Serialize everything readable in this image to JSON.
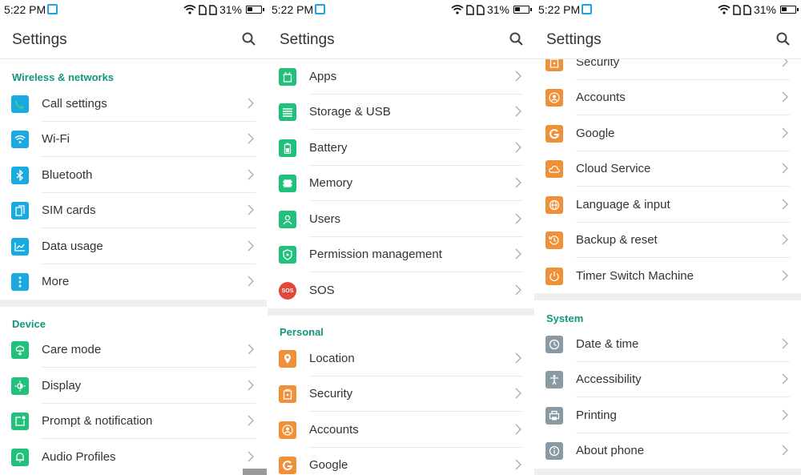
{
  "status": {
    "time": "5:22 PM",
    "battery": "31%"
  },
  "panels": [
    {
      "title": "Settings",
      "sections": [
        {
          "header": "Wireless & networks",
          "items": [
            {
              "label": "Call settings",
              "icon": "phone-icon",
              "color": "#1aa9e0"
            },
            {
              "label": "Wi-Fi",
              "icon": "wifi-icon",
              "color": "#1aa9e0"
            },
            {
              "label": "Bluetooth",
              "icon": "bluetooth-icon",
              "color": "#1aa9e0"
            },
            {
              "label": "SIM cards",
              "icon": "sim-icon",
              "color": "#1aa9e0"
            },
            {
              "label": "Data usage",
              "icon": "chart-icon",
              "color": "#1aa9e0"
            },
            {
              "label": "More",
              "icon": "more-icon",
              "color": "#1aa9e0"
            }
          ]
        },
        {
          "header": "Device",
          "items": [
            {
              "label": "Care mode",
              "icon": "care-icon",
              "color": "#21c17c"
            },
            {
              "label": "Display",
              "icon": "display-icon",
              "color": "#21c17c"
            },
            {
              "label": "Prompt & notification",
              "icon": "notification-icon",
              "color": "#21c17c"
            },
            {
              "label": "Audio Profiles",
              "icon": "bell-icon",
              "color": "#21c17c"
            }
          ]
        }
      ]
    },
    {
      "title": "Settings",
      "sections": [
        {
          "header": "",
          "items": [
            {
              "label": "Apps",
              "icon": "android-icon",
              "color": "#21c17c"
            },
            {
              "label": "Storage & USB",
              "icon": "storage-icon",
              "color": "#21c17c"
            },
            {
              "label": "Battery",
              "icon": "battery-icon",
              "color": "#21c17c"
            },
            {
              "label": "Memory",
              "icon": "memory-icon",
              "color": "#21c17c"
            },
            {
              "label": "Users",
              "icon": "user-icon",
              "color": "#21c17c"
            },
            {
              "label": "Permission management",
              "icon": "shield-icon",
              "color": "#21c17c"
            },
            {
              "label": "SOS",
              "icon": "sos-icon",
              "color": "#e0483a"
            }
          ]
        },
        {
          "header": "Personal",
          "items": [
            {
              "label": "Location",
              "icon": "location-icon",
              "color": "#f0913a"
            },
            {
              "label": "Security",
              "icon": "lock-icon",
              "color": "#f0913a"
            },
            {
              "label": "Accounts",
              "icon": "account-icon",
              "color": "#f0913a"
            },
            {
              "label": "Google",
              "icon": "google-icon",
              "color": "#f0913a"
            }
          ]
        }
      ]
    },
    {
      "title": "Settings",
      "sections": [
        {
          "header": "",
          "items": [
            {
              "label": "Security",
              "icon": "lock-icon",
              "color": "#f0913a"
            },
            {
              "label": "Accounts",
              "icon": "account-icon",
              "color": "#f0913a"
            },
            {
              "label": "Google",
              "icon": "google-icon",
              "color": "#f0913a"
            },
            {
              "label": "Cloud Service",
              "icon": "cloud-icon",
              "color": "#f0913a"
            },
            {
              "label": "Language & input",
              "icon": "globe-icon",
              "color": "#f0913a"
            },
            {
              "label": "Backup & reset",
              "icon": "backup-icon",
              "color": "#f0913a"
            },
            {
              "label": "Timer Switch Machine",
              "icon": "power-icon",
              "color": "#f0913a"
            }
          ]
        },
        {
          "header": "System",
          "items": [
            {
              "label": "Date & time",
              "icon": "clock-icon",
              "color": "#8a9aa5"
            },
            {
              "label": "Accessibility",
              "icon": "accessibility-icon",
              "color": "#8a9aa5"
            },
            {
              "label": "Printing",
              "icon": "printer-icon",
              "color": "#8a9aa5"
            },
            {
              "label": "About phone",
              "icon": "info-icon",
              "color": "#8a9aa5"
            }
          ]
        }
      ]
    }
  ]
}
